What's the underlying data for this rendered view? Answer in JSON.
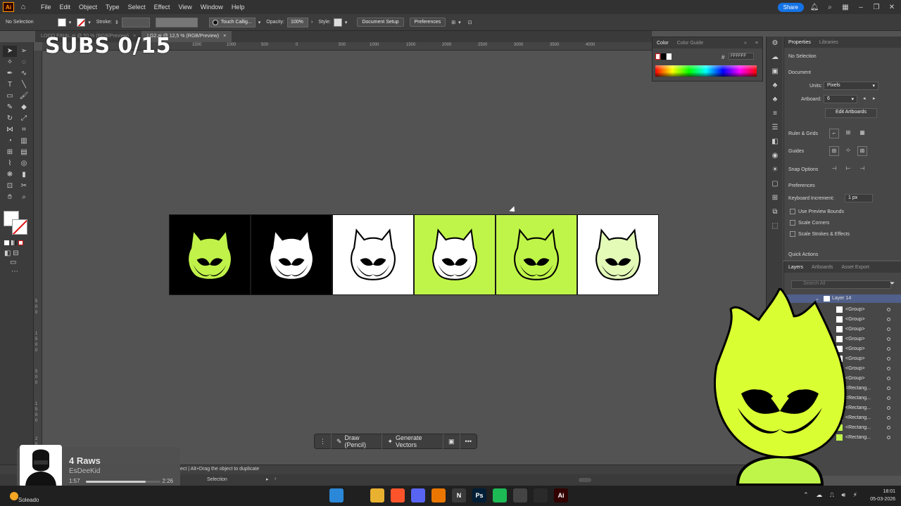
{
  "menubar": {
    "app_logo": "Ai",
    "menu": [
      "File",
      "Edit",
      "Object",
      "Type",
      "Select",
      "Effect",
      "View",
      "Window",
      "Help"
    ],
    "share": "Share"
  },
  "controlbar": {
    "selection": "No Selection",
    "stroke_label": "Stroke:",
    "brush": "Touch Callig...",
    "opacity_label": "Opacity:",
    "opacity_value": "100%",
    "style_label": "Style:",
    "document_setup": "Document Setup",
    "preferences": "Preferences"
  },
  "tabs": [
    {
      "label": "LOGO FINAL.ai @ 50 % (RGB/Preview)"
    },
    {
      "label": "LG2.ai @ 12,5 % (RGB/Preview)"
    }
  ],
  "ruler": {
    "h_labels": [
      "2000",
      "1500",
      "1000",
      "500",
      "0",
      "500",
      "1000",
      "1500",
      "2000",
      "2500",
      "3000",
      "3500",
      "4000"
    ],
    "v_labels": [
      "5",
      "0",
      "0",
      "1",
      "5",
      "0",
      "0",
      "5",
      "0",
      "0",
      "1",
      "5",
      "0",
      "0",
      "2",
      "5",
      "0",
      "0"
    ]
  },
  "overlay": {
    "subs": "SUBS 0/15"
  },
  "artboards": [
    {
      "bg": "#000000",
      "logo_fill": "#c0f24a"
    },
    {
      "bg": "#000000",
      "logo_fill": "#ffffff"
    },
    {
      "bg": "#ffffff",
      "logo_fill": "#ffffff"
    },
    {
      "bg": "#bff549",
      "logo_fill": "#ffffff"
    },
    {
      "bg": "#bff549",
      "logo_fill": "#bff549"
    },
    {
      "bg": "#ffffff",
      "logo_fill": "#e4fbb8"
    }
  ],
  "contextbar": {
    "draw": "Draw (Pencil)",
    "generate": "Generate Vectors"
  },
  "status": {
    "hint": "ect  |  Alt+Drag the object to duplicate",
    "tool": "Selection"
  },
  "colorpanel": {
    "tabs": [
      "Color",
      "Color Guide"
    ],
    "hex": "FFFFFF"
  },
  "properties": {
    "tabs": [
      "Properties",
      "Libraries"
    ],
    "selection": "No Selection",
    "document_label": "Document",
    "units_label": "Units:",
    "units_value": "Pixels",
    "artboard_label": "Artboard:",
    "artboard_value": "6",
    "edit_artboards": "Edit Artboards",
    "ruler_grids": "Ruler & Grids",
    "guides": "Guides",
    "snap_options": "Snap Options",
    "preferences": "Preferences",
    "keyboard_increment_label": "Keyboard Increment:",
    "keyboard_increment_value": "1 px",
    "use_preview_bounds": "Use Preview Bounds",
    "scale_corners": "Scale Corners",
    "scale_strokes": "Scale Strokes & Effects",
    "quick_actions": "Quick Actions"
  },
  "layers": {
    "tabs": [
      "Layers",
      "Artboards",
      "Asset Export"
    ],
    "search_placeholder": "Search All",
    "layer_name": "Layer 14",
    "items": [
      {
        "name": "<Group>",
        "swatch": "#ffffff"
      },
      {
        "name": "<Group>",
        "swatch": "#ffffff"
      },
      {
        "name": "<Group>",
        "swatch": "#ffffff"
      },
      {
        "name": "<Group>",
        "swatch": "#ffffff"
      },
      {
        "name": "<Group>",
        "swatch": "#ffffff"
      },
      {
        "name": "<Group>",
        "swatch": "#ffffff"
      },
      {
        "name": "<Group>",
        "swatch": "#ffffff"
      },
      {
        "name": "<Group>",
        "swatch": "#ffffff"
      },
      {
        "name": "<Rectang...",
        "swatch": "#000000"
      },
      {
        "name": "<Rectang...",
        "swatch": "#000000"
      },
      {
        "name": "<Rectang...",
        "swatch": "#ffffff"
      },
      {
        "name": "<Rectang...",
        "swatch": "#ffffff"
      },
      {
        "name": "<Rectang...",
        "swatch": "#bff549"
      },
      {
        "name": "<Rectang...",
        "swatch": "#bff549"
      }
    ]
  },
  "player": {
    "title": "4 Raws",
    "artist": "EsDeeKid",
    "elapsed": "1:57",
    "duration": "2:26",
    "progress": 0.8
  },
  "taskbar": {
    "weather": "Soleado",
    "time": "18:01",
    "date": "05-03-2026",
    "apps": [
      {
        "name": "windows-start",
        "label": "",
        "color": "#2b88d8"
      },
      {
        "name": "search",
        "label": "",
        "color": "#202020"
      },
      {
        "name": "file-explorer",
        "label": "",
        "color": "#e8b130"
      },
      {
        "name": "brave",
        "label": "",
        "color": "#fb542b"
      },
      {
        "name": "discord",
        "label": "",
        "color": "#5865f2"
      },
      {
        "name": "blender",
        "label": "",
        "color": "#ea7600"
      },
      {
        "name": "notion",
        "label": "N",
        "color": "#3a3a3a"
      },
      {
        "name": "photoshop",
        "label": "Ps",
        "color": "#001e36"
      },
      {
        "name": "spotify",
        "label": "",
        "color": "#1db954"
      },
      {
        "name": "app",
        "label": "",
        "color": "#444444"
      },
      {
        "name": "obs",
        "label": "",
        "color": "#2a2a2a"
      },
      {
        "name": "illustrator",
        "label": "Ai",
        "color": "#330000"
      }
    ]
  },
  "colors": {
    "accent_lime": "#bff549",
    "share_blue": "#1473e6",
    "illustrator_orange": "#ff9a00"
  }
}
